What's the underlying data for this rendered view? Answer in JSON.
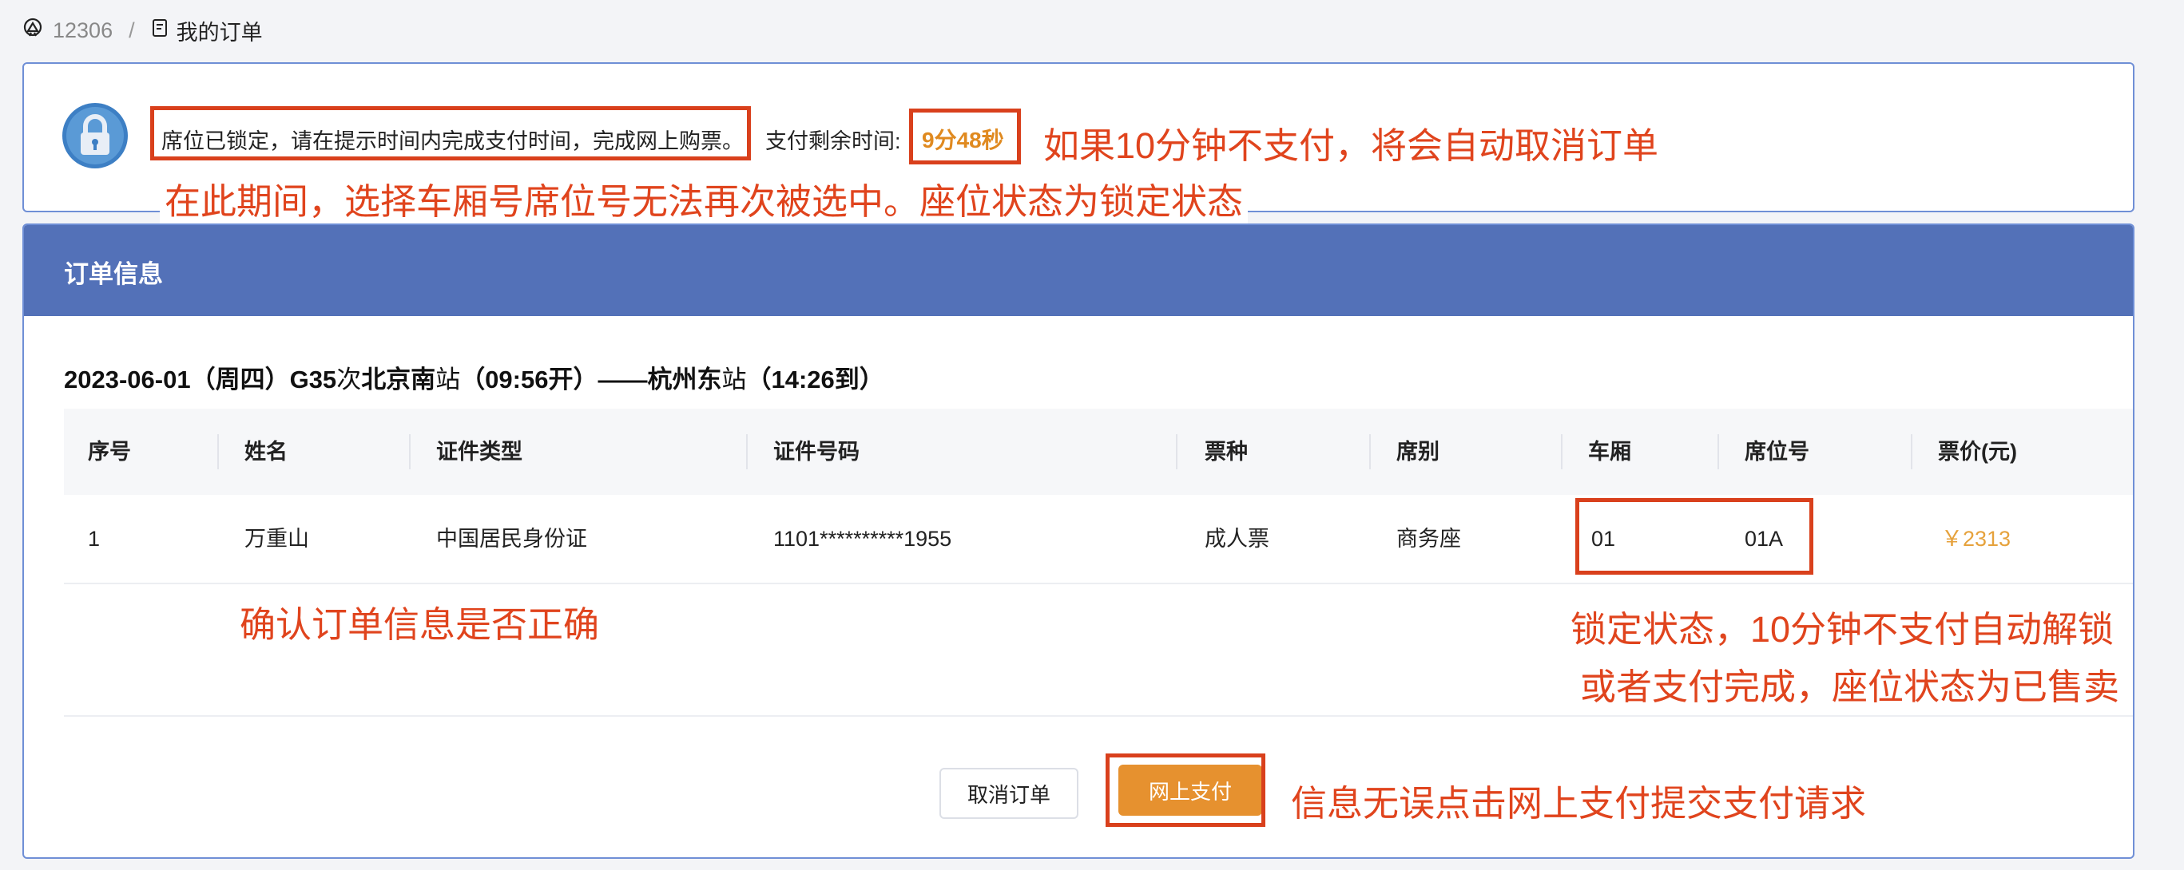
{
  "breadcrumb": {
    "home": "12306",
    "separator": "/",
    "current": "我的订单"
  },
  "notice": {
    "message": "席位已锁定，请在提示时间内完成支付时间，完成网上购票。",
    "remaining_label": "支付剩余时间:",
    "remaining_time": "9分48秒"
  },
  "annotations": {
    "cancel_warning": "如果10分钟不支付，将会自动取消订单",
    "lock_note": "在此期间，选择车厢号席位号无法再次被选中。座位状态为锁定状态",
    "confirm_note": "确认订单信息是否正确",
    "lock_state_line1": "锁定状态，10分钟不支付自动解锁",
    "lock_state_line2": "或者支付完成，座位状态为已售卖",
    "pay_note": "信息无误点击网上支付提交支付请求"
  },
  "order": {
    "title": "订单信息",
    "trip": {
      "date": "2023-06-01（周四）",
      "train": "G35",
      "train_suffix": "次",
      "from": "北京南",
      "station_suffix": "站",
      "depart": "（09:56开）",
      "dash": "——",
      "to": "杭州东",
      "arrive": "（14:26到）"
    },
    "columns": [
      "序号",
      "姓名",
      "证件类型",
      "证件号码",
      "票种",
      "席别",
      "车厢",
      "席位号",
      "票价(元)"
    ],
    "rows": [
      {
        "no": "1",
        "name": "万重山",
        "id_type": "中国居民身份证",
        "id_number": "1101**********1955",
        "ticket_type": "成人票",
        "seat_class": "商务座",
        "carriage": "01",
        "seat_no": "01A",
        "price": "￥2313"
      }
    ]
  },
  "buttons": {
    "cancel": "取消订单",
    "pay": "网上支付"
  },
  "colors": {
    "header": "#5371b8",
    "accent": "#e6912f",
    "annotation": "#e0441d"
  }
}
